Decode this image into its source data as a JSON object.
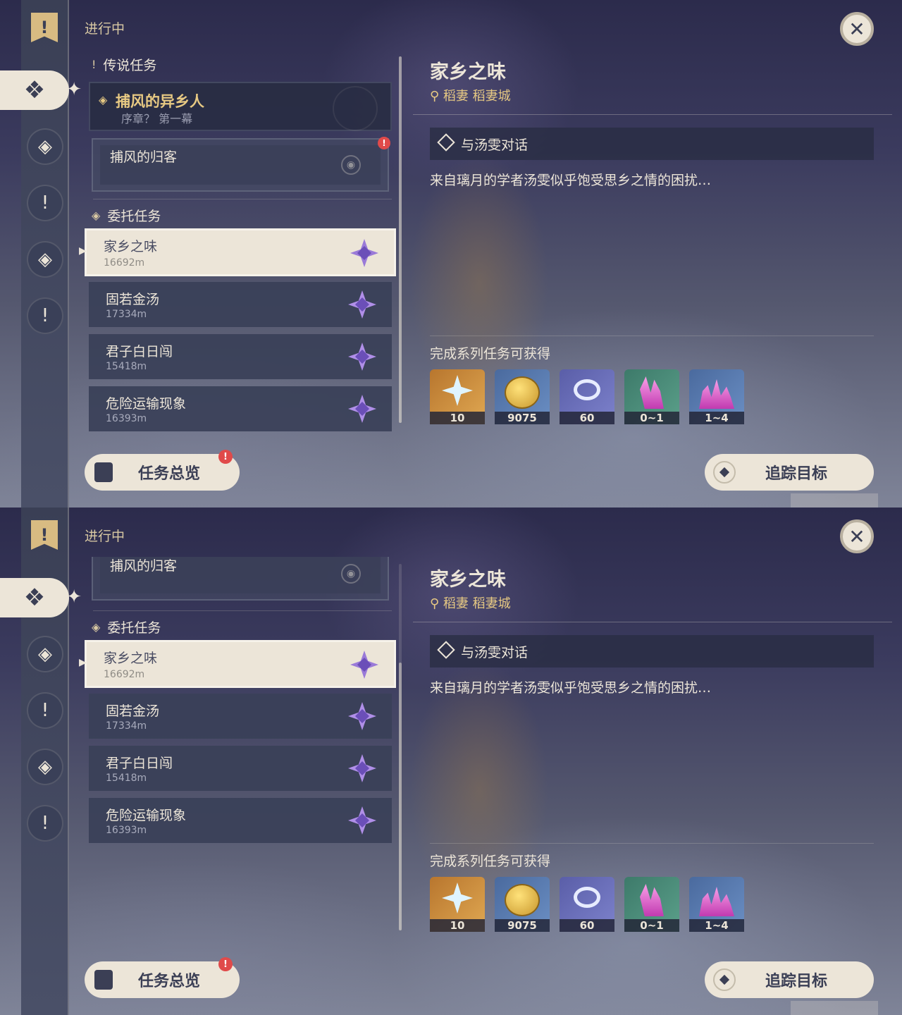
{
  "status_title": "进行中",
  "rail": {
    "flag_icon": "quest-banner-icon",
    "active_icon": "quest-four-diamond-icon",
    "icons": [
      "archon-quest-icon",
      "story-quest-icon",
      "commission-quest-icon",
      "world-quest-icon"
    ],
    "flag_glyph": "!",
    "active_glyph": "❖",
    "spark": "✦",
    "glyphs": [
      "◈",
      "!",
      "◈",
      "!"
    ]
  },
  "close_glyph": "✕",
  "sections": {
    "legend_label": "传说任务",
    "commission_label": "委托任务"
  },
  "legend_quest": {
    "title": "捕风的异乡人",
    "subtitle": "序章？ 第一幕"
  },
  "sub_quest": {
    "title": "捕风的归客",
    "badge": "!",
    "pin_glyph": "◉"
  },
  "quests": [
    {
      "title": "家乡之味",
      "distance": "16692m"
    },
    {
      "title": "固若金汤",
      "distance": "17334m"
    },
    {
      "title": "君子白日闯",
      "distance": "15418m"
    },
    {
      "title": "危险运输现象",
      "distance": "16393m"
    }
  ],
  "detail": {
    "title": "家乡之味",
    "location": "⚲ 稻妻 稻妻城",
    "objective": "与汤雯对话",
    "description": "来自璃月的学者汤雯似乎饱受思乡之情的困扰…",
    "rewards_title": "完成系列任务可获得",
    "rewards": [
      {
        "name": "primogem",
        "amount": "10"
      },
      {
        "name": "mora",
        "amount": "9075"
      },
      {
        "name": "companionship-exp",
        "amount": "60"
      },
      {
        "name": "crystal-chunk",
        "amount": "0~1"
      },
      {
        "name": "crystal-cluster",
        "amount": "1~4"
      }
    ]
  },
  "buttons": {
    "overview": "任务总览",
    "overview_badge": "!",
    "track": "追踪目标"
  },
  "panels": [
    {
      "scroll_position": 0.0
    },
    {
      "scroll_position": 1.0
    }
  ]
}
